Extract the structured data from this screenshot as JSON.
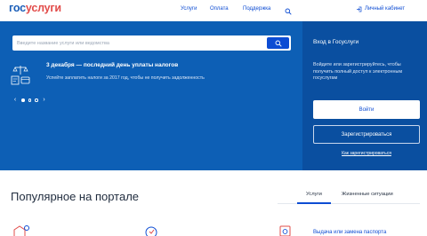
{
  "logo": {
    "part1": "гос",
    "part2": "услуги"
  },
  "nav": {
    "items": [
      "Услуги",
      "Оплата",
      "Поддержка"
    ],
    "cabinet": "Личный кабинет"
  },
  "search": {
    "placeholder": "Введите название услуги или ведомства"
  },
  "promo": {
    "title": "3 декабря — последний день уплаты налогов",
    "text": "Успейте заплатить налоги за 2017 год, чтобы не получить задолженность"
  },
  "login": {
    "title": "Вход в Госуслуги",
    "description": "Войдите или зарегистрируйтесь, чтобы получить полный доступ к электронным госуслугам",
    "login_button": "Войти",
    "register_button": "Зарегистрироваться",
    "how_link": "Как зарегистрироваться"
  },
  "popular": {
    "title": "Популярное на портале",
    "tabs": [
      "Услуги",
      "Жизненные ситуации"
    ],
    "link": "Выдача или замена паспорта"
  },
  "colors": {
    "brand_blue": "#0d5fb5",
    "accent_blue": "#0d4cd3",
    "logo_red": "#e24c4a"
  }
}
